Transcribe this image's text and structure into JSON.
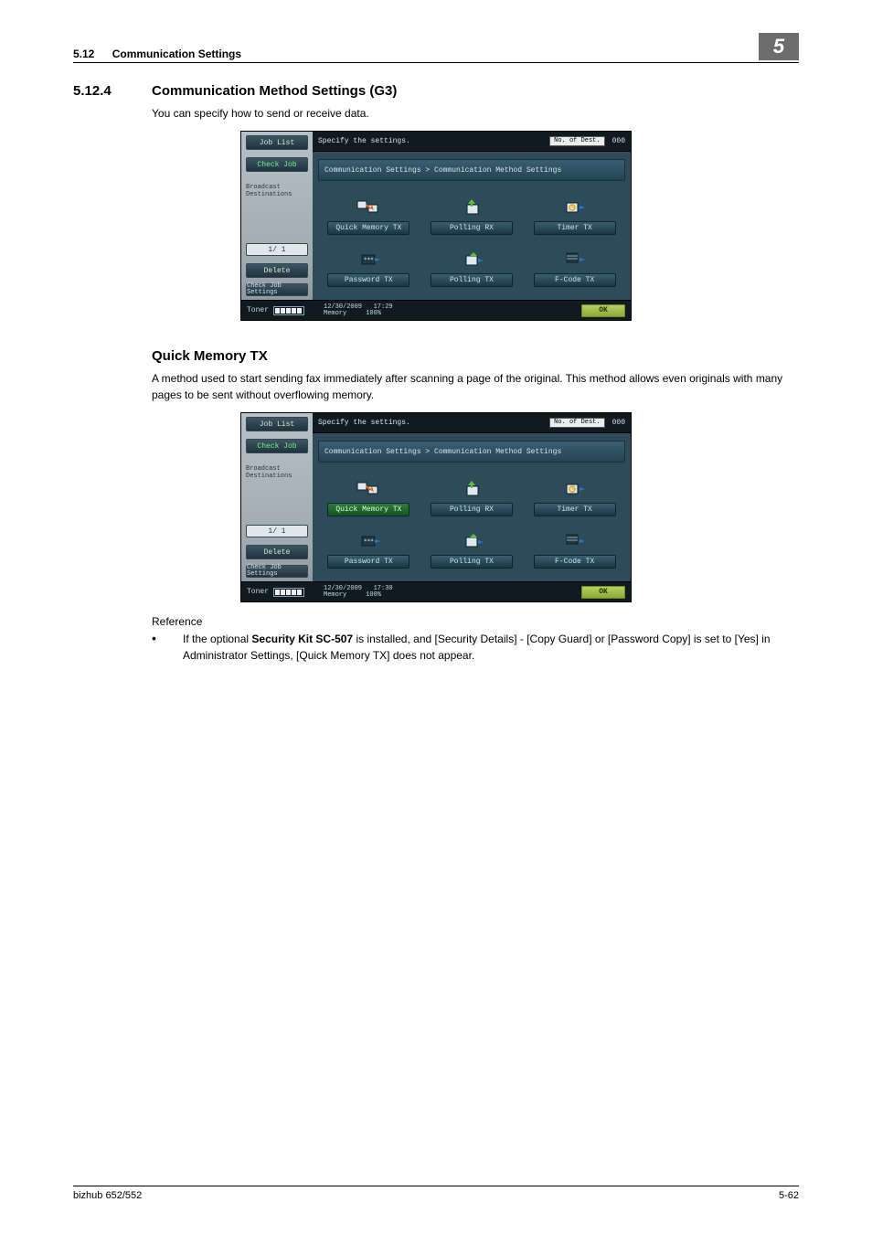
{
  "header": {
    "section_number": "5.12",
    "section_title": "Communication Settings",
    "chapter": "5"
  },
  "section": {
    "number": "5.12.4",
    "title": "Communication Method Settings (G3)",
    "intro": "You can specify how to send or receive data."
  },
  "sub": {
    "title": "Quick Memory TX",
    "body": "A method used to start sending fax immediately after scanning a page of the original. This method allows even originals with many pages to be sent without overflowing memory."
  },
  "reference": {
    "label": "Reference",
    "bullet_prefix": "If the optional ",
    "bold": "Security Kit SC-507",
    "bullet_suffix": " is installed, and [Security Details] - [Copy Guard] or [Password Copy] is set to [Yes] in Administrator Settings, [Quick Memory TX] does not appear."
  },
  "screenshot_common": {
    "side": {
      "job_list": "Job List",
      "check_job": "Check Job",
      "broadcast": "Broadcast\nDestinations",
      "page": "1/  1",
      "delete": "Delete",
      "check_settings": "Check Job\nSettings"
    },
    "main": {
      "instruction": "Specify the settings.",
      "dest_label": "No. of\nDest.",
      "dest_count": "000",
      "breadcrumb": "Communication Settings > Communication Method Settings",
      "options": [
        "Quick Memory TX",
        "Polling RX",
        "Timer TX",
        "Password TX",
        "Polling TX",
        "F-Code TX"
      ]
    },
    "bottom": {
      "toner": "Toner",
      "date": "12/30/2009",
      "memory": "Memory",
      "mempct": "100%",
      "ok": "OK"
    }
  },
  "shots": [
    {
      "time": "17:29",
      "selected_index": -1
    },
    {
      "time": "17:30",
      "selected_index": 0
    }
  ],
  "footer": {
    "left": "bizhub 652/552",
    "right": "5-62"
  }
}
